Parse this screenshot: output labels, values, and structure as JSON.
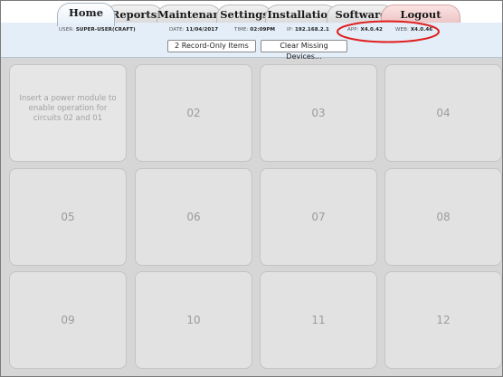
{
  "tabs": [
    {
      "label": "Home",
      "active": true
    },
    {
      "label": "Reports",
      "active": false
    },
    {
      "label": "Maintenance",
      "active": false
    },
    {
      "label": "Settings",
      "active": false
    },
    {
      "label": "Installation",
      "active": false
    },
    {
      "label": "Software",
      "active": false
    },
    {
      "label": "Logout",
      "active": false
    }
  ],
  "info": {
    "user_label": "USER:",
    "user_value": "SUPER-USER(CRAFT)",
    "date_label": "DATE:",
    "date_value": "11/04/2017",
    "time_label": "TIME:",
    "time_value": "02:09PM",
    "ip_label": "IP:",
    "ip_value": "192.168.2.1",
    "app_label": "APP:",
    "app_value": "X4.0.42",
    "web_label": "WEB:",
    "web_value": "X4.0.46"
  },
  "buttons": {
    "record_only": "2 Record-Only Items",
    "clear_missing": "Clear Missing Devices..."
  },
  "cells": [
    {
      "label": "Insert a power module to enable operation for circuits 02 and 01"
    },
    {
      "label": "02"
    },
    {
      "label": "03"
    },
    {
      "label": "04"
    },
    {
      "label": "05"
    },
    {
      "label": "06"
    },
    {
      "label": "07"
    },
    {
      "label": "08"
    },
    {
      "label": "09"
    },
    {
      "label": "10"
    },
    {
      "label": "11"
    },
    {
      "label": "12"
    }
  ],
  "colors": {
    "annotation": "#e02020",
    "infobar": "#e4eef8",
    "cell": "#e2e2e2"
  }
}
